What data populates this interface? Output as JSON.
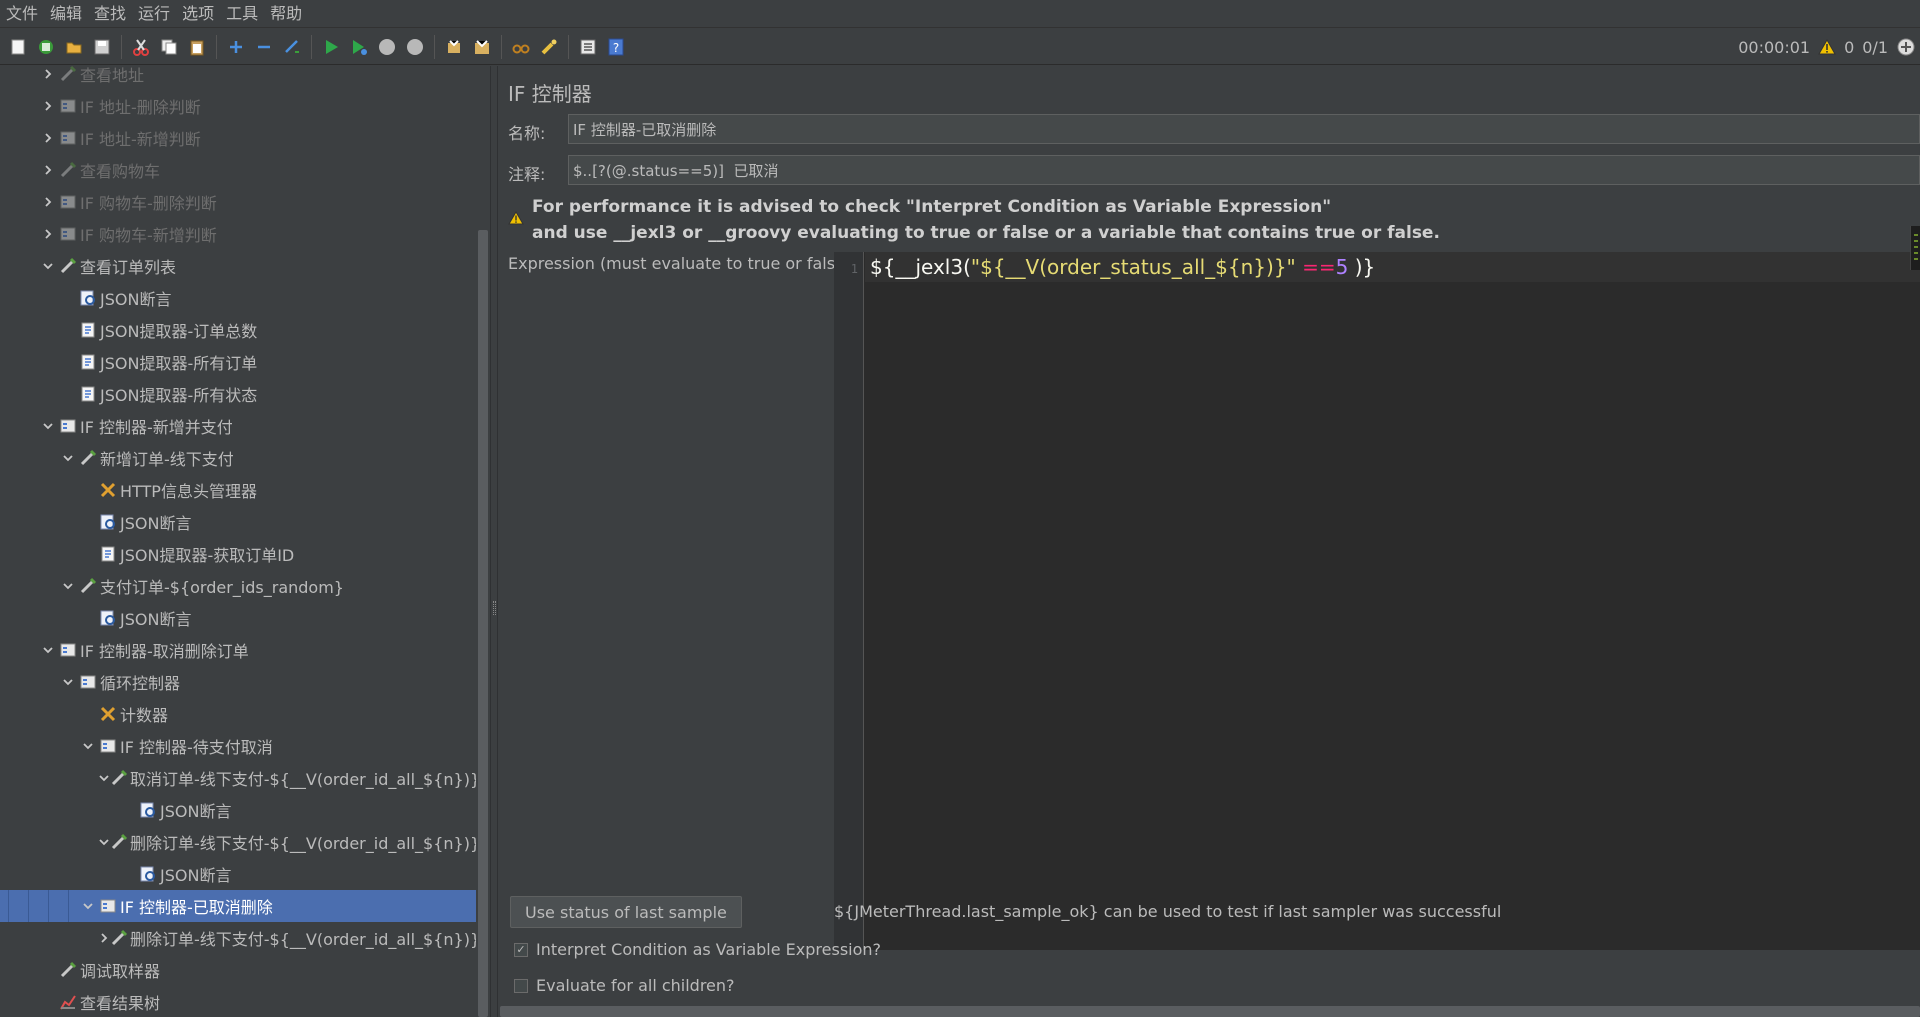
{
  "menu": [
    "文件",
    "编辑",
    "查找",
    "运行",
    "选项",
    "工具",
    "帮助"
  ],
  "toolbar": {
    "buttons": [
      "new-icon",
      "templates-icon",
      "open-icon",
      "save-icon",
      "cut-icon",
      "copy-icon",
      "paste-icon",
      "expand-icon",
      "collapse-icon",
      "toggle-icon",
      "start-icon",
      "start-no-pause-icon",
      "stop-icon",
      "shutdown-icon",
      "clear-icon",
      "clear-all-icon",
      "search-icon",
      "reset-search-icon",
      "function-helper-icon",
      "help-icon"
    ],
    "timer": "00:00:01",
    "warning_count": "0",
    "threads": "0/1"
  },
  "tree": [
    {
      "depth": 1,
      "expanded": false,
      "icon": "sampler",
      "label": "查看地址",
      "disabled": true
    },
    {
      "depth": 1,
      "expanded": false,
      "icon": "controller",
      "label": "IF 地址-删除判断",
      "disabled": true
    },
    {
      "depth": 1,
      "expanded": false,
      "icon": "controller",
      "label": "IF 地址-新增判断",
      "disabled": true
    },
    {
      "depth": 1,
      "expanded": false,
      "icon": "sampler",
      "label": "查看购物车",
      "disabled": true
    },
    {
      "depth": 1,
      "expanded": false,
      "icon": "controller",
      "label": "IF 购物车-删除判断",
      "disabled": true
    },
    {
      "depth": 1,
      "expanded": false,
      "icon": "controller",
      "label": "IF 购物车-新增判断",
      "disabled": true
    },
    {
      "depth": 1,
      "expanded": true,
      "icon": "sampler",
      "label": "查看订单列表"
    },
    {
      "depth": 2,
      "icon": "assertion",
      "label": "JSON断言"
    },
    {
      "depth": 2,
      "icon": "extractor",
      "label": "JSON提取器-订单总数"
    },
    {
      "depth": 2,
      "icon": "extractor",
      "label": "JSON提取器-所有订单"
    },
    {
      "depth": 2,
      "icon": "extractor",
      "label": "JSON提取器-所有状态"
    },
    {
      "depth": 1,
      "expanded": true,
      "icon": "controller",
      "label": "IF 控制器-新增并支付"
    },
    {
      "depth": 2,
      "expanded": true,
      "icon": "sampler",
      "label": "新增订单-线下支付"
    },
    {
      "depth": 3,
      "icon": "config",
      "label": "HTTP信息头管理器"
    },
    {
      "depth": 3,
      "icon": "assertion",
      "label": "JSON断言"
    },
    {
      "depth": 3,
      "icon": "extractor",
      "label": "JSON提取器-获取订单ID"
    },
    {
      "depth": 2,
      "expanded": true,
      "icon": "sampler",
      "label": "支付订单-${order_ids_random}"
    },
    {
      "depth": 3,
      "icon": "assertion",
      "label": "JSON断言"
    },
    {
      "depth": 1,
      "expanded": true,
      "icon": "controller",
      "label": "IF 控制器-取消删除订单"
    },
    {
      "depth": 2,
      "expanded": true,
      "icon": "controller",
      "label": "循环控制器"
    },
    {
      "depth": 3,
      "icon": "config",
      "label": "计数器"
    },
    {
      "depth": 3,
      "expanded": true,
      "icon": "controller",
      "label": "IF 控制器-待支付取消"
    },
    {
      "depth": 4,
      "expanded": true,
      "icon": "sampler",
      "label": "取消订单-线下支付-${__V(order_id_all_${n})}"
    },
    {
      "depth": 5,
      "icon": "assertion",
      "label": "JSON断言"
    },
    {
      "depth": 4,
      "expanded": true,
      "icon": "sampler",
      "label": "删除订单-线下支付-${__V(order_id_all_${n})}"
    },
    {
      "depth": 5,
      "icon": "assertion",
      "label": "JSON断言"
    },
    {
      "depth": 3,
      "expanded": true,
      "icon": "controller",
      "label": "IF 控制器-已取消删除",
      "selected": true
    },
    {
      "depth": 4,
      "expanded": false,
      "icon": "sampler",
      "label": "删除订单-线下支付-${__V(order_id_all_${n})}"
    },
    {
      "depth": 1,
      "icon": "sampler",
      "label": "调试取样器"
    },
    {
      "depth": 1,
      "icon": "listener",
      "label": "查看结果树"
    }
  ],
  "editor": {
    "title": "IF 控制器",
    "name_label": "名称:",
    "name_value": "IF 控制器-已取消删除",
    "comment_label": "注释:",
    "comment_value": "$..[?(@.status==5)]  已取消",
    "warning_line1": "For performance it is advised to check \"Interpret Condition as Variable Expression\"",
    "warning_line2": "and use __jexl3 or __groovy evaluating to true or false or a variable that contains true or false.",
    "expression_label": "Expression (must evaluate to true or false)",
    "line_number": "1",
    "code": {
      "p1": "${__jexl3(",
      "p2": "\"${__V(order_status_all_${n})}\"",
      "p3": " ",
      "p4": "==",
      "p5": "5",
      "p6": " )}"
    },
    "use_status_button": "Use status of last sample",
    "hint": "${JMeterThread.last_sample_ok} can be used to test if last sampler was successful",
    "interpret_label": "Interpret Condition as Variable Expression?",
    "interpret_checked": true,
    "evaluate_all_label": "Evaluate for all children?",
    "evaluate_all_checked": false
  },
  "colors": {
    "background": "#3c3f41",
    "selection": "#4b6eaf",
    "editor_bg": "#2b2b2b",
    "string": "#e6db74",
    "operator": "#f92672",
    "number": "#ae81ff"
  }
}
